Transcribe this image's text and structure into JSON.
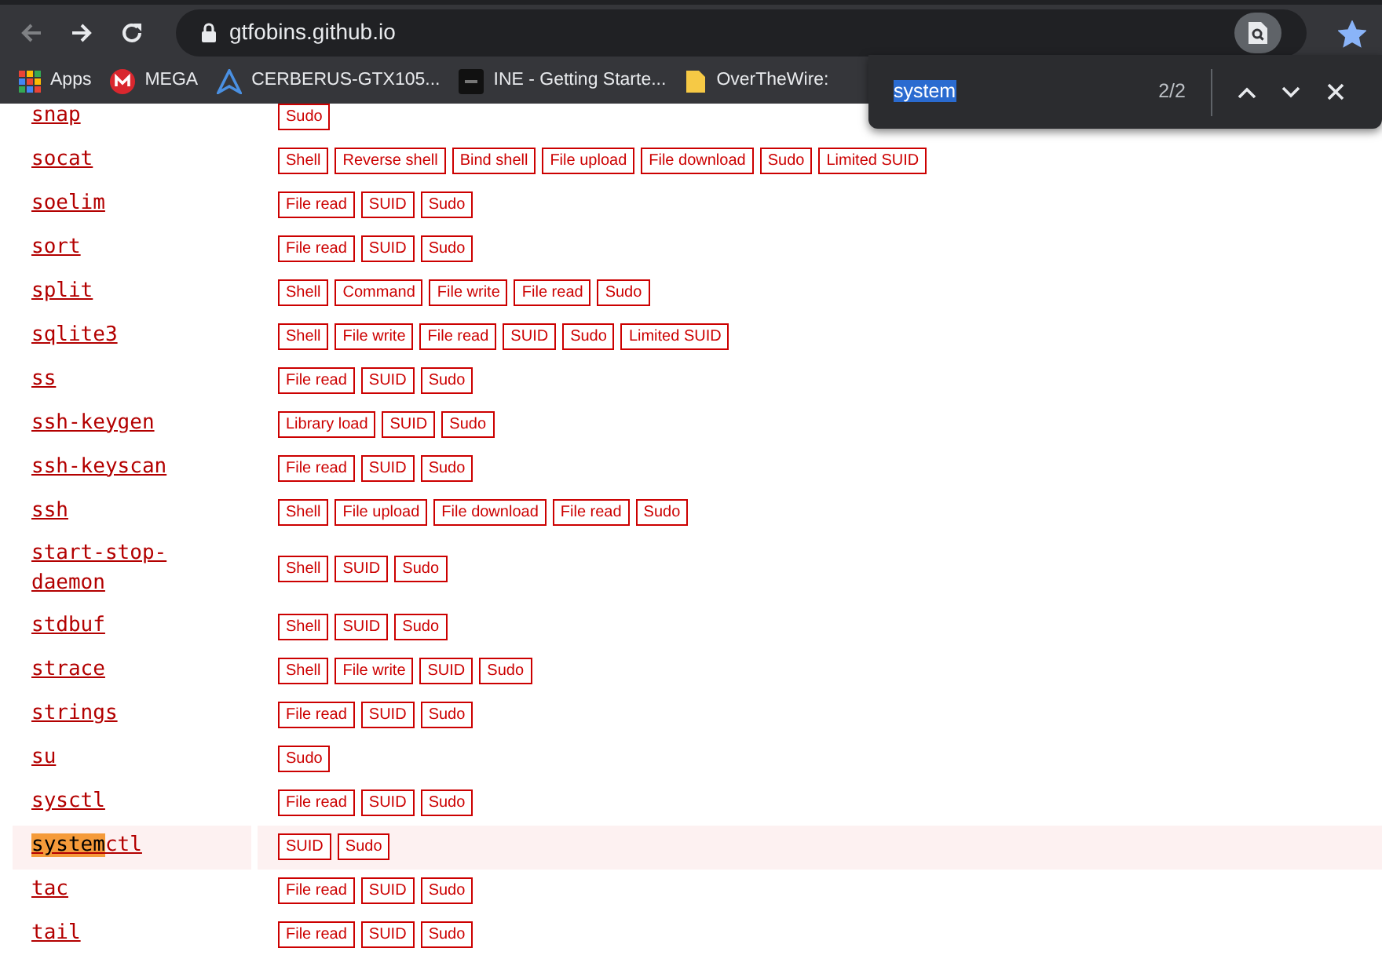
{
  "browser": {
    "back_disabled": true,
    "url": "gtfobins.github.io",
    "bookmarked": true,
    "bookmarks": [
      {
        "kind": "apps",
        "label": "Apps"
      },
      {
        "kind": "mega",
        "label": "MEGA"
      },
      {
        "kind": "cerberus",
        "label": "CERBERUS-GTX105..."
      },
      {
        "kind": "ine",
        "label": "INE - Getting Starte..."
      },
      {
        "kind": "page",
        "label": "OverTheWire:"
      }
    ]
  },
  "find_bar": {
    "query": "system",
    "count": "2/2"
  },
  "rows": [
    {
      "name": "snap",
      "selected": false,
      "functions": [
        "Sudo"
      ]
    },
    {
      "name": "socat",
      "selected": false,
      "functions": [
        "Shell",
        "Reverse shell",
        "Bind shell",
        "File upload",
        "File download",
        "Sudo",
        "Limited SUID"
      ]
    },
    {
      "name": "soelim",
      "selected": false,
      "functions": [
        "File read",
        "SUID",
        "Sudo"
      ]
    },
    {
      "name": "sort",
      "selected": false,
      "functions": [
        "File read",
        "SUID",
        "Sudo"
      ]
    },
    {
      "name": "split",
      "selected": false,
      "functions": [
        "Shell",
        "Command",
        "File write",
        "File read",
        "Sudo"
      ]
    },
    {
      "name": "sqlite3",
      "selected": false,
      "functions": [
        "Shell",
        "File write",
        "File read",
        "SUID",
        "Sudo",
        "Limited SUID"
      ]
    },
    {
      "name": "ss",
      "selected": false,
      "functions": [
        "File read",
        "SUID",
        "Sudo"
      ]
    },
    {
      "name": "ssh-keygen",
      "selected": false,
      "functions": [
        "Library load",
        "SUID",
        "Sudo"
      ]
    },
    {
      "name": "ssh-keyscan",
      "selected": false,
      "functions": [
        "File read",
        "SUID",
        "Sudo"
      ]
    },
    {
      "name": "ssh",
      "selected": false,
      "functions": [
        "Shell",
        "File upload",
        "File download",
        "File read",
        "Sudo"
      ]
    },
    {
      "name": "start-stop-daemon",
      "selected": false,
      "functions": [
        "Shell",
        "SUID",
        "Sudo"
      ]
    },
    {
      "name": "stdbuf",
      "selected": false,
      "functions": [
        "Shell",
        "SUID",
        "Sudo"
      ]
    },
    {
      "name": "strace",
      "selected": false,
      "functions": [
        "Shell",
        "File write",
        "SUID",
        "Sudo"
      ]
    },
    {
      "name": "strings",
      "selected": false,
      "functions": [
        "File read",
        "SUID",
        "Sudo"
      ]
    },
    {
      "name": "su",
      "selected": false,
      "functions": [
        "Sudo"
      ]
    },
    {
      "name": "sysctl",
      "selected": false,
      "functions": [
        "File read",
        "SUID",
        "Sudo"
      ]
    },
    {
      "name_segments": [
        {
          "text": "system",
          "match": true
        },
        {
          "text": "ctl",
          "match": false
        }
      ],
      "selected": true,
      "functions": [
        "SUID",
        "Sudo"
      ]
    },
    {
      "name": "tac",
      "selected": false,
      "functions": [
        "File read",
        "SUID",
        "Sudo"
      ]
    },
    {
      "name": "tail",
      "selected": false,
      "functions": [
        "File read",
        "SUID",
        "Sudo"
      ]
    }
  ]
}
